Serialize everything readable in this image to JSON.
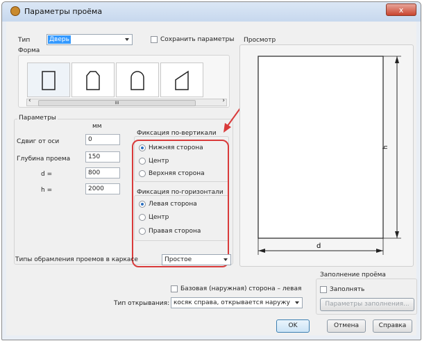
{
  "window": {
    "title": "Параметры проёма",
    "close_glyph": "x"
  },
  "top": {
    "type_label": "Тип",
    "type_value": "Дверь",
    "save_params_label": "Сохранить параметры",
    "form_label": "Форма",
    "scroll_thumb": "III",
    "shapes": [
      "rectangle",
      "chamfered",
      "arched",
      "slanted"
    ]
  },
  "params": {
    "title": "Параметры",
    "unit": "мм",
    "rows": [
      {
        "label": "Сдвиг от оси",
        "value": "0"
      },
      {
        "label": "Глубина проема",
        "value": "150"
      },
      {
        "label": "d =",
        "value": "800"
      },
      {
        "label": "h =",
        "value": "2000"
      }
    ]
  },
  "vertical": {
    "title": "Фиксация по-вертикали",
    "options": [
      "Нижняя сторона",
      "Центр",
      "Верхняя сторона"
    ],
    "selected": 0
  },
  "horizontal": {
    "title": "Фиксация по-горизонтали",
    "options": [
      "Левая сторона",
      "Центр",
      "Правая сторона"
    ],
    "selected": 0
  },
  "frame": {
    "label": "Типы обрамления проемов в каркасе",
    "value": "Простое"
  },
  "preview": {
    "title": "Просмотр",
    "dim_d": "d",
    "dim_h": "h"
  },
  "opening": {
    "base_side_label": "Базовая (наружная) сторона – левая",
    "type_label": "Тип открывания:",
    "type_value": "косяк справа, открывается наружу"
  },
  "fill": {
    "title": "Заполнение проёма",
    "checkbox_label": "Заполнять",
    "params_button": "Параметры заполнения..."
  },
  "buttons": {
    "ok": "OK",
    "cancel": "Отмена",
    "help": "Справка"
  },
  "colors": {
    "annotation": "#d93a3a",
    "accent": "#2b6fbf",
    "selection": "#3399ff"
  },
  "icons": [
    "app-icon",
    "close-icon",
    "dropdown-arrow-icon",
    "scroll-left-icon",
    "scroll-right-icon",
    "annotation-arrow-icon"
  ]
}
